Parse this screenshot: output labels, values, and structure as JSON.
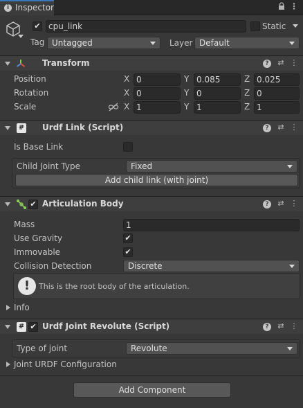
{
  "window": {
    "tab_label": "Inspector",
    "tab_icon": "info-icon",
    "toolbar_icons": [
      "lock-icon",
      "kebab-menu-icon"
    ]
  },
  "gameobject": {
    "active": true,
    "name": "cpu_link",
    "static_label": "Static",
    "static_checked": false,
    "tag_label": "Tag",
    "tag_value": "Untagged",
    "layer_label": "Layer",
    "layer_value": "Default"
  },
  "transform": {
    "title": "Transform",
    "position_label": "Position",
    "rotation_label": "Rotation",
    "scale_label": "Scale",
    "axes": [
      "X",
      "Y",
      "Z"
    ],
    "position": [
      "0",
      "0.085",
      "0.025"
    ],
    "rotation": [
      "0",
      "0",
      "0"
    ],
    "scale": [
      "1",
      "1",
      "1"
    ]
  },
  "urdf_link": {
    "title": "Urdf Link (Script)",
    "is_base_label": "Is Base Link",
    "is_base_checked": false,
    "child_joint_label": "Child Joint Type",
    "child_joint_value": "Fixed",
    "add_child_button": "Add child link (with joint)"
  },
  "articulation": {
    "title": "Articulation Body",
    "enabled": true,
    "mass_label": "Mass",
    "mass_value": "1",
    "use_gravity_label": "Use Gravity",
    "use_gravity": true,
    "immovable_label": "Immovable",
    "immovable": true,
    "collision_label": "Collision Detection",
    "collision_value": "Discrete",
    "help_text": "This is the root body of the articulation.",
    "info_label": "Info"
  },
  "joint_revolute": {
    "title": "Urdf Joint Revolute (Script)",
    "enabled": true,
    "type_label": "Type of joint",
    "type_value": "Revolute",
    "config_label": "Joint URDF Configuration"
  },
  "add_component_button": "Add Component",
  "colors": {
    "panel_bg": "#383838",
    "header_bg": "#3e3e3e",
    "field_bg": "#2a2a2a",
    "tab_accent": "#3a79bb",
    "text": "#c4c4c4"
  }
}
